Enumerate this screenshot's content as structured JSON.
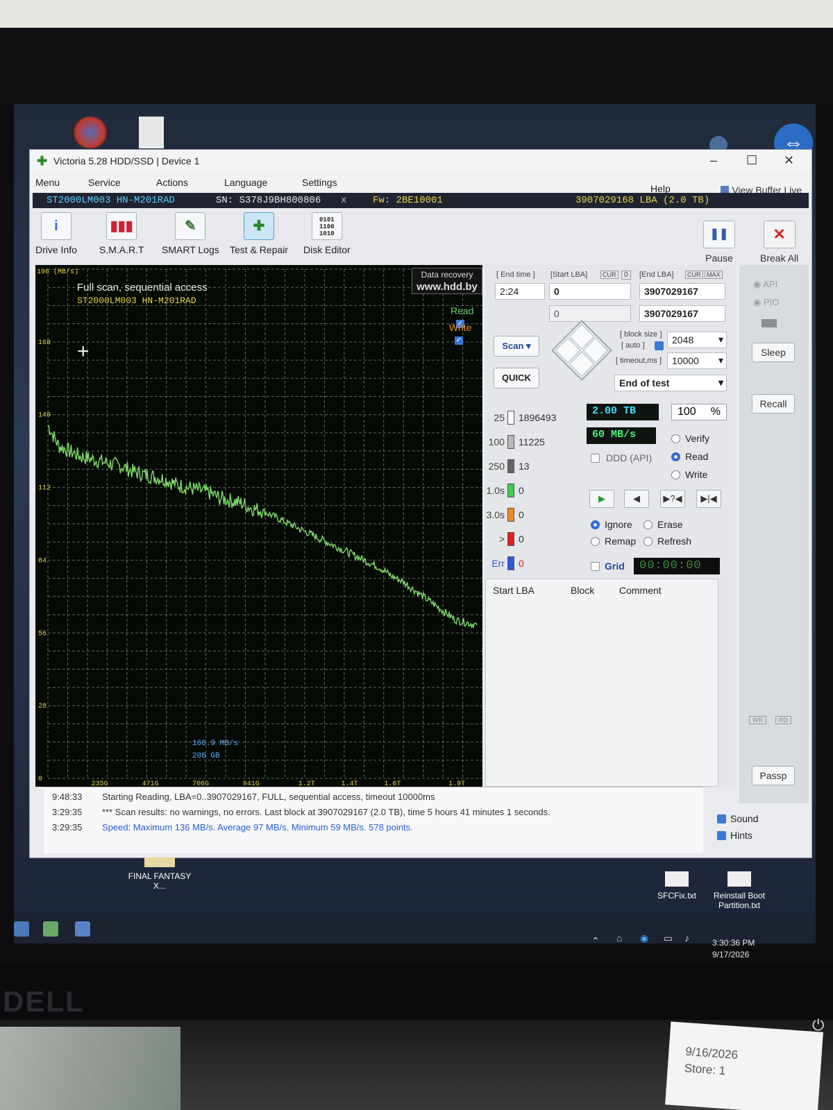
{
  "window": {
    "title": "Victoria 5.28 HDD/SSD | Device 1"
  },
  "menu": {
    "items": [
      "Menu",
      "Service",
      "Actions",
      "Language",
      "Settings"
    ],
    "help": "Help",
    "view_buffer": "View Buffer Live"
  },
  "drive": {
    "model": "ST2000LM003 HN-M201RAD",
    "serial": "SN: S378J9BH800806",
    "close_x": "x",
    "firmware": "Fw: 2BE10001",
    "lba": "3907029168 LBA (2.0 TB)"
  },
  "toolbar": {
    "drive_info": "Drive Info",
    "smart": "S.M.A.R.T",
    "smart_logs": "SMART Logs",
    "test_repair": "Test & Repair",
    "disk_editor": "Disk Editor",
    "pause": "Pause",
    "break_all": "Break All"
  },
  "graph": {
    "y_unit": "196 (MB/s)",
    "title": "Full scan, sequential access",
    "model": "ST2000LM003 HN-M201RAD",
    "recovery_line1": "Data recovery",
    "recovery_line2": "www.hdd.by",
    "read_label": "Read",
    "write_label": "Write",
    "cursor_speed": "166.9 MB/s",
    "cursor_pos": "208 GB",
    "colors": {
      "trace": "#7fdc6a",
      "grid": "#5a6a5a",
      "axis_text": "#e6d44a",
      "background": "#050a05"
    }
  },
  "chart_data": {
    "type": "line",
    "title": "Full scan, sequential access",
    "xlabel": "",
    "ylabel": "(MB/s)",
    "ylim": [
      0,
      196
    ],
    "y_ticks": [
      "168",
      "140",
      "112",
      "84",
      "56",
      "28",
      "0"
    ],
    "x_ticks": [
      "235G",
      "471G",
      "706G",
      "941G",
      "1.2T",
      "1.4T",
      "1.6T",
      "1.9T"
    ],
    "grid": true,
    "series": [
      {
        "x_gb": [
          0,
          50,
          100,
          150,
          200,
          250,
          300,
          350,
          400,
          450,
          500,
          550,
          600,
          650,
          700,
          750,
          800,
          850,
          900,
          950,
          1000,
          1050,
          1100,
          1150,
          1200,
          1250,
          1300,
          1350,
          1400,
          1450,
          1500,
          1550,
          1600,
          1650,
          1700,
          1750,
          1800,
          1850,
          1900,
          1950,
          2000
        ],
        "values": [
          136,
          128,
          126,
          124,
          123,
          122,
          121,
          120,
          118,
          117,
          116,
          115,
          113,
          112,
          111,
          110,
          108,
          107,
          106,
          104,
          103,
          101,
          99,
          97,
          95,
          93,
          91,
          89,
          87,
          85,
          83,
          81,
          78,
          76,
          73,
          70,
          67,
          64,
          61,
          60,
          59
        ]
      }
    ]
  },
  "controls": {
    "end_time_label": "[ End time ]",
    "end_time_value": "2:24",
    "start_lba_label": "[Start LBA]",
    "cur_label": "CUR",
    "start_cur_value": "0",
    "start_lba_value": "0",
    "start_lba_value2": "0",
    "end_lba_label": "[End LBA]",
    "end_cur_label": "CUR",
    "max_label": "MAX",
    "end_lba_value": "3907029167",
    "end_lba_value2": "3907029167",
    "block_size_label": "[ block size ]",
    "auto_label": "[ auto ]",
    "block_size_value": "2048",
    "timeout_label": "[ timeout,ms ]",
    "timeout_value": "10000",
    "scan_button": "Scan",
    "quick_button": "QUICK",
    "end_of_test": "End of test"
  },
  "histogram": [
    {
      "label": "25",
      "value": "1896493",
      "color": "#ffffff"
    },
    {
      "label": "100",
      "value": "11225",
      "color": "#b8b8b8"
    },
    {
      "label": "250",
      "value": "13",
      "color": "#666666"
    },
    {
      "label": "1.0s",
      "value": "0",
      "color": "#3ccf4e"
    },
    {
      "label": "3.0s",
      "value": "0",
      "color": "#f08a24"
    },
    {
      "label": ">",
      "value": "0",
      "color": "#e02020"
    },
    {
      "label": "Err",
      "value": "0",
      "color": "#2e5ad8"
    }
  ],
  "status": {
    "size": "2.00 TB",
    "percent": "100",
    "percent_sign": "%",
    "speed": "60 MB/s",
    "ddd_label": "DDD (API)",
    "verify": "Verify",
    "read": "Read",
    "write": "Write",
    "ignore": "Ignore",
    "erase": "Erase",
    "remap": "Remap",
    "refresh": "Refresh",
    "grid": "Grid",
    "timer": "00:00:00"
  },
  "table": {
    "headers": [
      "Start LBA",
      "Block",
      "Comment"
    ]
  },
  "side": {
    "api": "API",
    "pio": "PIO",
    "sleep": "Sleep",
    "recall": "Recall",
    "wr": "WR",
    "rd": "RD",
    "passp": "Passp"
  },
  "log": [
    {
      "time": "9:48:33",
      "msg": "Starting Reading, LBA=0..3907029167, FULL, sequential access, timeout 10000ms",
      "color": "#333333"
    },
    {
      "time": "3:29:35",
      "msg": "*** Scan results: no warnings, no errors. Last block at 3907029167 (2.0 TB), time 5 hours 41 minutes 1 seconds.",
      "color": "#333333"
    },
    {
      "time": "3:29:35",
      "msg": "Speed: Maximum 136 MB/s. Average 97 MB/s. Minimum 59 MB/s. 578 points.",
      "color": "#2a5ed0"
    }
  ],
  "options": {
    "sound": "Sound",
    "hints": "Hints"
  },
  "desktop": {
    "icon_ff": "FINAL FANTASY X...",
    "icon_sfc": "SFCFix.txt",
    "icon_reinstall": "Reinstall Boot Partition.txt"
  },
  "taskbar": {
    "time": "3:30:36 PM",
    "date": "9/17/2026"
  },
  "photo": {
    "brand": "DELL",
    "note_date": "9/16/2026",
    "note_store": "Store: 1"
  }
}
